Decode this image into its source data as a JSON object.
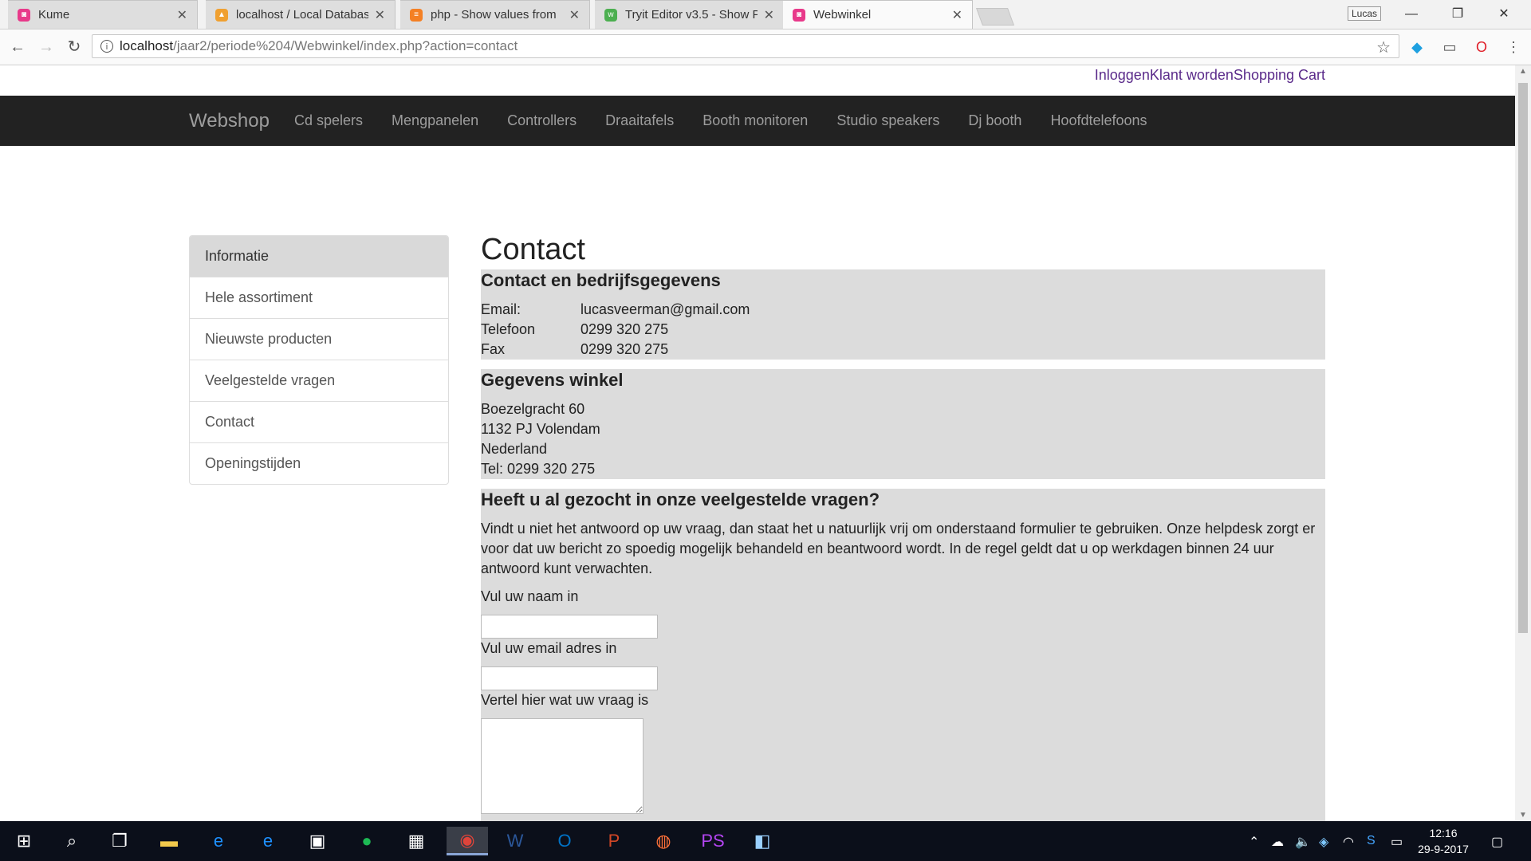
{
  "browser": {
    "tabs": [
      {
        "title": "Kume",
        "favicon_color": "#e8398a",
        "active": false
      },
      {
        "title": "localhost / Local Databas",
        "favicon_color": "#f0a030",
        "active": false
      },
      {
        "title": "php - Show values from",
        "favicon_color": "#f48024",
        "active": false
      },
      {
        "title": "Tryit Editor v3.5 - Show P",
        "favicon_color": "#4caf50",
        "active": false
      },
      {
        "title": "Webwinkel",
        "favicon_color": "#e8398a",
        "active": true
      }
    ],
    "profile_name": "Lucas",
    "url_host": "localhost",
    "url_path": "/jaar2/periode%204/Webwinkel/index.php?action=contact"
  },
  "page": {
    "top_links": [
      "Inloggen",
      "Klant worden",
      "Shopping Cart"
    ],
    "brand": "Webshop",
    "nav": [
      "Cd spelers",
      "Mengpanelen",
      "Controllers",
      "Draaitafels",
      "Booth monitoren",
      "Studio speakers",
      "Dj booth",
      "Hoofdtelefoons"
    ],
    "sidebar": [
      "Informatie",
      "Hele assortiment",
      "Nieuwste producten",
      "Veelgestelde vragen",
      "Contact",
      "Openingstijden"
    ],
    "title": "Contact",
    "contact": {
      "heading": "Contact en bedrijfsgegevens",
      "email_label": "Email:",
      "email_value": "lucasveerman@gmail.com",
      "phone_label": "Telefoon",
      "phone_value": "0299 320 275",
      "fax_label": "Fax",
      "fax_value": "0299 320 275"
    },
    "store": {
      "heading": "Gegevens winkel",
      "lines": [
        "Boezelgracht 60",
        "1132 PJ Volendam",
        "Nederland",
        "Tel: 0299 320 275"
      ]
    },
    "faq": {
      "heading": "Heeft u al gezocht in onze veelgestelde vragen?",
      "text": "Vindt u niet het antwoord op uw vraag, dan staat het u natuurlijk vrij om onderstaand formulier te gebruiken. Onze helpdesk zorgt er voor dat uw bericht zo spoedig mogelijk behandeld en beantwoord wordt. In de regel geldt dat u op werkdagen binnen 24 uur antwoord kunt verwachten.",
      "name_label": "Vul uw naam in",
      "name_value": "",
      "email_label": "Vul uw email adres in",
      "email_value": "",
      "question_label": "Vertel hier wat uw vraag is",
      "question_value": ""
    }
  },
  "taskbar": {
    "time": "12:16",
    "date": "29-9-2017"
  },
  "colors": {
    "navbar": "#222222",
    "panel": "#dcdcdc",
    "link": "#5a2a8a",
    "active_sidebar": "#d9d9d9"
  }
}
